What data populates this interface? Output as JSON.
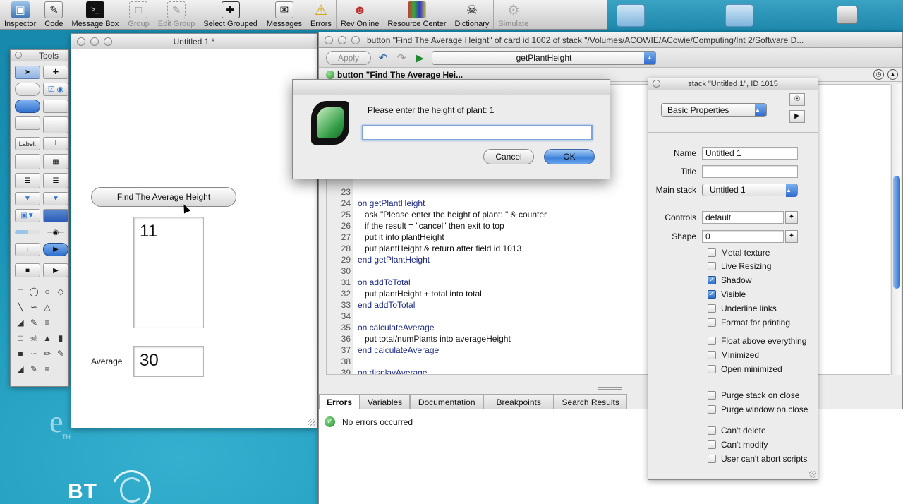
{
  "toolbar": {
    "items": [
      {
        "label": "Inspector",
        "icon": "inspector-icon",
        "enabled": true
      },
      {
        "label": "Code",
        "icon": "code-icon",
        "enabled": true
      },
      {
        "label": "Message Box",
        "icon": "message-box-icon",
        "enabled": true
      },
      {
        "label": "Group",
        "icon": "group-icon",
        "enabled": false
      },
      {
        "label": "Edit Group",
        "icon": "edit-group-icon",
        "enabled": false
      },
      {
        "label": "Select Grouped",
        "icon": "select-grouped-icon",
        "enabled": true
      },
      {
        "label": "Messages",
        "icon": "messages-icon",
        "enabled": true
      },
      {
        "label": "Errors",
        "icon": "errors-icon",
        "enabled": true
      },
      {
        "label": "Rev Online",
        "icon": "rev-online-icon",
        "enabled": true
      },
      {
        "label": "Resource Center",
        "icon": "resource-center-icon",
        "enabled": true
      },
      {
        "label": "Dictionary",
        "icon": "dictionary-icon",
        "enabled": true
      },
      {
        "label": "Simulate",
        "icon": "simulate-icon",
        "enabled": false
      }
    ]
  },
  "tools_palette": {
    "title": "Tools",
    "label_tool": "Label:"
  },
  "stack_window": {
    "title": "Untitled 1 *",
    "button_label": "Find The Average Height",
    "list_field_value": "11",
    "average_label": "Average",
    "average_value": "30"
  },
  "script_editor": {
    "title": "button \"Find The Average Height\" of card id 1002 of stack \"/Volumes/ACOWIE/ACowie/Computing/Int 2/Software D...",
    "apply_label": "Apply",
    "handler_selected": "getPlantHeight",
    "script_tab_label": "button \"Find The Average Hei...",
    "bottom_tabs": [
      "Errors",
      "Variables",
      "Documentation",
      "Breakpoints",
      "Search Results"
    ],
    "active_bottom_tab": "Errors",
    "status_message": "No errors occurred",
    "lines": [
      {
        "num": "23",
        "text": ""
      },
      {
        "num": "24",
        "text": "on getPlantHeight"
      },
      {
        "num": "25",
        "text": "   ask \"Please enter the height of plant: \" & counter"
      },
      {
        "num": "26",
        "text": "   if the result = \"cancel\" then exit to top"
      },
      {
        "num": "27",
        "text": "   put it into plantHeight"
      },
      {
        "num": "28",
        "text": "   put plantHeight & return after field id 1013"
      },
      {
        "num": "29",
        "text": "end getPlantHeight"
      },
      {
        "num": "30",
        "text": ""
      },
      {
        "num": "31",
        "text": "on addToTotal"
      },
      {
        "num": "32",
        "text": "   put plantHeight + total into total"
      },
      {
        "num": "33",
        "text": "end addToTotal"
      },
      {
        "num": "34",
        "text": ""
      },
      {
        "num": "35",
        "text": "on calculateAverage"
      },
      {
        "num": "36",
        "text": "   put total/numPlants into averageHeight"
      },
      {
        "num": "37",
        "text": "end calculateAverage"
      },
      {
        "num": "38",
        "text": ""
      },
      {
        "num": "39",
        "text": "on displayAverage"
      }
    ]
  },
  "inspector": {
    "title": "stack \"Untitled 1\", ID 1015",
    "properties_selected": "Basic Properties",
    "name_label": "Name",
    "name_value": "Untitled 1",
    "title_label": "Title",
    "title_value": "",
    "mainstack_label": "Main stack",
    "mainstack_value": "Untitled 1",
    "controls_label": "Controls",
    "controls_value": "default",
    "shape_label": "Shape",
    "shape_value": "0",
    "checkboxes": [
      {
        "label": "Metal texture",
        "checked": false
      },
      {
        "label": "Live Resizing",
        "checked": false
      },
      {
        "label": "Shadow",
        "checked": true
      },
      {
        "label": "Visible",
        "checked": true
      },
      {
        "label": "Underline links",
        "checked": false
      },
      {
        "label": "Format for printing",
        "checked": false
      },
      {
        "label": "Float above everything",
        "checked": false
      },
      {
        "label": "Minimized",
        "checked": false
      },
      {
        "label": "Open minimized",
        "checked": false
      },
      {
        "label": "Purge stack on close",
        "checked": false
      },
      {
        "label": "Purge window on close",
        "checked": false
      },
      {
        "label": "Can't delete",
        "checked": false
      },
      {
        "label": "Can't modify",
        "checked": false
      },
      {
        "label": "User can't abort scripts",
        "checked": false
      }
    ]
  },
  "ask_dialog": {
    "prompt": "Please enter the height of plant: 1",
    "input_value": "",
    "cancel_label": "Cancel",
    "ok_label": "OK"
  },
  "desktop": {
    "brand_text": "BT",
    "wallpaper_letter": "e",
    "wallpaper_small_text": "TH"
  },
  "colors": {
    "accent_blue": "#2f6fce",
    "desktop": "#1a94b7",
    "ok_green": "#1f8a2e"
  }
}
